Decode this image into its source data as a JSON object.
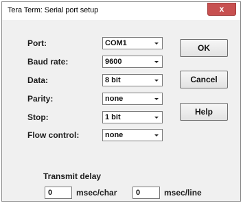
{
  "window": {
    "title": "Tera Term: Serial port setup",
    "close_label": "x"
  },
  "fields": {
    "port": {
      "label": "Port:",
      "value": "COM1"
    },
    "baud": {
      "label": "Baud rate:",
      "value": "9600"
    },
    "data": {
      "label": "Data:",
      "value": "8 bit"
    },
    "parity": {
      "label": "Parity:",
      "value": "none"
    },
    "stop": {
      "label": "Stop:",
      "value": "1 bit"
    },
    "flow": {
      "label": "Flow control:",
      "value": "none"
    }
  },
  "buttons": {
    "ok": "OK",
    "cancel": "Cancel",
    "help": "Help"
  },
  "transmit_delay": {
    "title": "Transmit delay",
    "char_value": "0",
    "char_unit": "msec/char",
    "line_value": "0",
    "line_unit": "msec/line"
  }
}
